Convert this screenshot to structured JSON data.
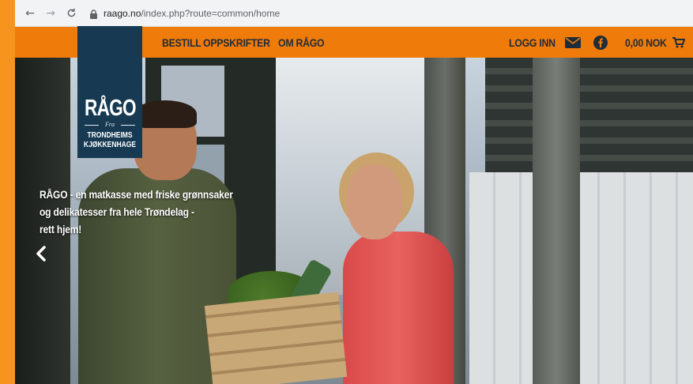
{
  "browser": {
    "url_host": "raago.no",
    "url_path": "/index.php?route=common/home"
  },
  "nav": {
    "items": [
      {
        "label": "BESTILL"
      },
      {
        "label": "OPPSKRIFTER"
      },
      {
        "label": "OM RÅGO"
      }
    ],
    "login_label": "LOGG INN",
    "cart_total": "0,00 NOK"
  },
  "logo": {
    "brand": "RÅGO",
    "fra": "Fra",
    "line1": "TRONDHEIMS",
    "line2": "KJØKKENHAGE"
  },
  "hero": {
    "tagline_lines": [
      "RÅGO - en matkasse med friske grønnsaker",
      "og delikatesser fra hele Trøndelag -",
      "rett hjem!"
    ]
  },
  "colors": {
    "accent_orange": "#ef7b0a",
    "navy": "#173a52",
    "nav_text": "#1f2d3a"
  },
  "icons": [
    "back-icon",
    "forward-icon",
    "reload-icon",
    "lock-icon",
    "mail-icon",
    "facebook-icon",
    "cart-icon",
    "chevron-left-icon"
  ]
}
